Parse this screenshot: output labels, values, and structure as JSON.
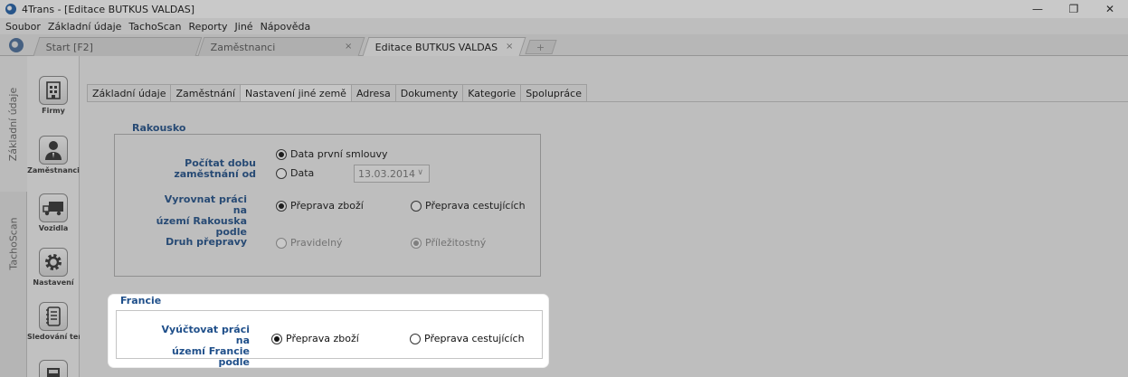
{
  "window": {
    "title": "4Trans - [Editace BUTKUS VALDAS]",
    "controls": [
      "—",
      "❐",
      "✕"
    ]
  },
  "menu": [
    "Soubor",
    "Základní údaje",
    "TachoScan",
    "Reporty",
    "Jiné",
    "Nápověda"
  ],
  "doc_tabs": {
    "start": "Start [F2]",
    "employees": "Zaměstnanci",
    "edit": "Editace BUTKUS VALDAS",
    "close": "×",
    "new": "+"
  },
  "side_tabs": [
    "Základní údaje",
    "TachoScan"
  ],
  "nav": {
    "firms": "Firmy",
    "employees": "Zaměstnanci",
    "vehicles": "Vozidla",
    "settings": "Nastavení",
    "tracking": "Sledování ter..."
  },
  "inner_tabs": [
    "Základní údaje",
    "Zaměstnání",
    "Nastavení jiné země",
    "Adresa",
    "Dokumenty",
    "Kategorie",
    "Spolupráce"
  ],
  "austria": {
    "title": "Rakousko",
    "count_label": "Počítat dobu zaměstnání od",
    "opt_first_contract": "Data první smlouvy",
    "opt_date": "Data",
    "date_value": "13.03.2014",
    "settle_label_1": "Vyrovnat práci na",
    "settle_label_2": "území Rakouska",
    "settle_label_3": "podle",
    "opt_goods": "Přeprava zboží",
    "opt_passengers": "Přeprava cestujících",
    "transport_type_label": "Druh přepravy",
    "opt_regular": "Pravidelný",
    "opt_occasional": "Příležitostný"
  },
  "france": {
    "title": "Francie",
    "settle_label_1": "Vyúčtovat práci na",
    "settle_label_2": "území Francie podle",
    "opt_goods": "Přeprava zboží",
    "opt_passengers": "Přeprava cestujících"
  }
}
